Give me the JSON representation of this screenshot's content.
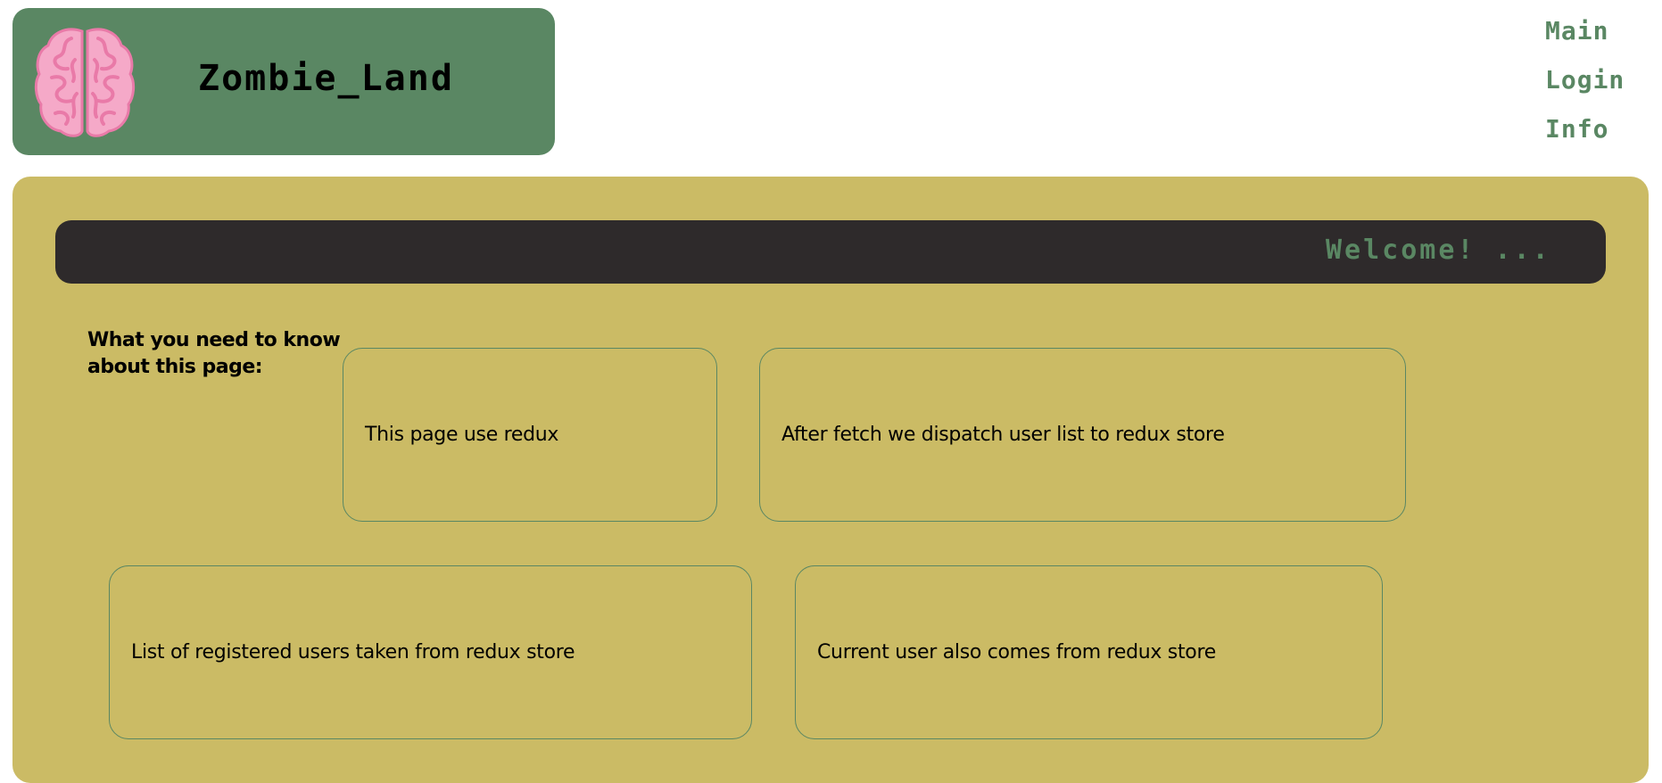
{
  "header": {
    "logo_icon": "brain-icon",
    "title": "Zombie_Land"
  },
  "nav": {
    "items": [
      {
        "label": "Main"
      },
      {
        "label": "Login"
      },
      {
        "label": "Info"
      }
    ]
  },
  "marquee": {
    "text": "Welcome! ..."
  },
  "info": {
    "heading": "What you need to know about this page:",
    "cards": [
      {
        "text": "This page use redux"
      },
      {
        "text": "After fetch we dispatch user list to redux store"
      },
      {
        "text": "List of registered users taken from redux store"
      },
      {
        "text": "Current user also comes from redux store"
      }
    ]
  },
  "colors": {
    "header_green": "#5a8763",
    "panel_mustard": "#cbbb65",
    "marquee_dark": "#2e2a2b",
    "brain_pink": "#f5a9c8",
    "brain_stroke": "#e97aa8"
  }
}
